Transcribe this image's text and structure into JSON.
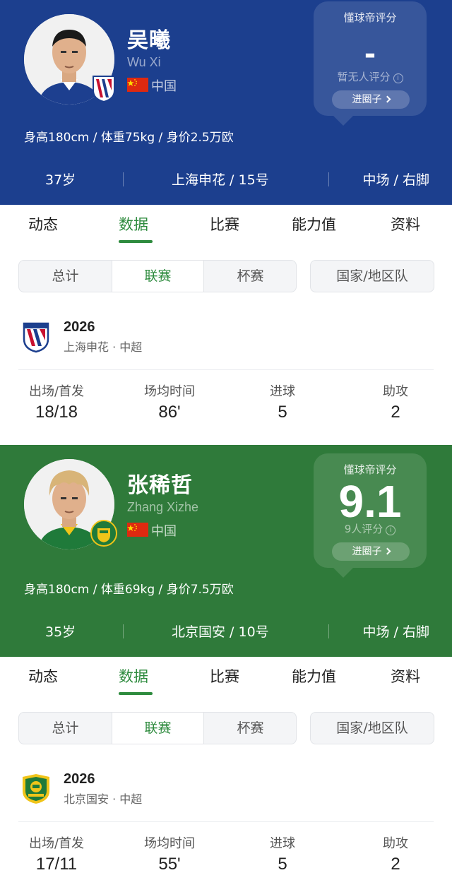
{
  "shared": {
    "rating_title": "懂球帝评分",
    "circle_button": "进圈子",
    "tabs": [
      "动态",
      "数据",
      "比赛",
      "能力值",
      "资料"
    ],
    "active_tab_index": 1,
    "segments": [
      "总计",
      "联赛",
      "杯赛"
    ],
    "active_segment_index": 1,
    "national_team_label": "国家/地区队",
    "stat_labels": [
      "出场/首发",
      "场均时间",
      "进球",
      "助攻"
    ]
  },
  "players": [
    {
      "header_color": "#1c3f8e",
      "name_cn": "吴曦",
      "name_en": "Wu Xi",
      "country": "中国",
      "rating_score": "-",
      "rating_count": "暂无人评分",
      "body_info": "身高180cm / 体重75kg / 身价2.5万欧",
      "age": "37岁",
      "club_number": "上海申花 / 15号",
      "position_foot": "中场 / 右脚",
      "club_logo": "shenhua-logo",
      "season_year": "2026",
      "season_club": "上海申花 · 中超",
      "stats": [
        "18/18",
        "86'",
        "5",
        "2"
      ]
    },
    {
      "header_color": "#2f7a3a",
      "name_cn": "张稀哲",
      "name_en": "Zhang Xizhe",
      "country": "中国",
      "rating_score": "9.1",
      "rating_count": "9人评分",
      "body_info": "身高180cm / 体重69kg / 身价7.5万欧",
      "age": "35岁",
      "club_number": "北京国安 / 10号",
      "position_foot": "中场 / 右脚",
      "club_logo": "guoan-logo",
      "season_year": "2026",
      "season_club": "北京国安 · 中超",
      "stats": [
        "17/11",
        "55'",
        "5",
        "2"
      ]
    }
  ],
  "colors": {
    "accent_green": "#2e8b3e",
    "shenhua_blue": "#1c3f8e",
    "guoan_green": "#2f7a3a"
  }
}
